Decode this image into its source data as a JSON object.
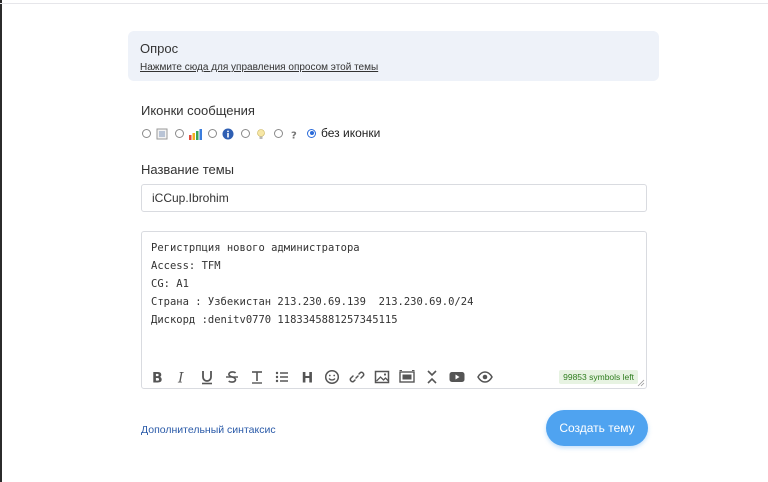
{
  "poll": {
    "title": "Опрос",
    "link": "Нажмите сюда для управления опросом этой темы"
  },
  "message_icons": {
    "label": "Иконки сообщения",
    "options": [
      {
        "icon": "image-icon",
        "checked": false
      },
      {
        "icon": "bar-chart-icon",
        "checked": false
      },
      {
        "icon": "info-icon",
        "checked": false
      },
      {
        "icon": "lightbulb-icon",
        "checked": false
      },
      {
        "icon": "question-icon",
        "checked": false
      }
    ],
    "no_icon_label": "без иконки",
    "no_icon_checked": true
  },
  "topic_title": {
    "label": "Название темы",
    "value": "iCCup.Ibrohim"
  },
  "editor": {
    "text": "Регистрпция нового администратора\nAccess: TFM\nCG: A1\nСтрана : Узбекистан 213.230.69.139  213.230.69.0/24\nДискорд :denitv0770 1183345881257345115",
    "toolbar": [
      "bold-icon",
      "italic-icon",
      "underline-icon",
      "strikethrough-icon",
      "text-size-icon",
      "list-icon",
      "heading-icon",
      "emoji-icon",
      "link-icon",
      "image-icon",
      "gallery-icon",
      "collapse-icon",
      "video-icon",
      "preview-icon"
    ],
    "counter": "99853 symbols left"
  },
  "footer": {
    "syntax_link": "Дополнительный синтаксис",
    "submit_label": "Создать тему"
  },
  "colors": {
    "accent": "#4fa3f0",
    "poll_bg": "#eef2f9",
    "link": "#2a5aa8",
    "counter_bg": "#e7f3e2",
    "counter_text": "#2e7d1e"
  }
}
